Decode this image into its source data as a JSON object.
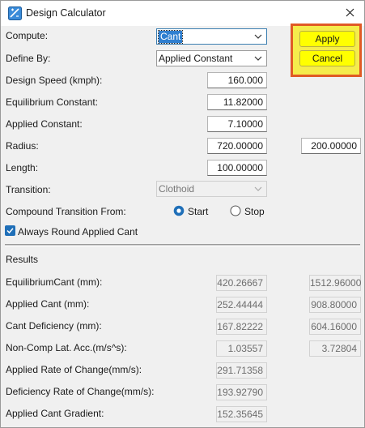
{
  "window": {
    "title": "Design Calculator"
  },
  "form": {
    "compute": {
      "label": "Compute:",
      "value": "Cant"
    },
    "define_by": {
      "label": "Define By:",
      "value": "Applied Constant"
    },
    "design_speed": {
      "label": "Design Speed (kmph):",
      "value": "160.000"
    },
    "equilibrium_constant": {
      "label": "Equilibrium Constant:",
      "value": "11.82000"
    },
    "applied_constant": {
      "label": "Applied Constant:",
      "value": "7.10000"
    },
    "radius": {
      "label": "Radius:",
      "value": "720.00000",
      "value2": "200.00000"
    },
    "length": {
      "label": "Length:",
      "value": "100.00000"
    },
    "transition": {
      "label": "Transition:",
      "value": "Clothoid"
    },
    "compound_transition": {
      "label": "Compound Transition From:",
      "options": [
        "Start",
        "Stop"
      ],
      "selected": "Start"
    },
    "always_round": {
      "label": "Always Round Applied Cant",
      "checked": true
    }
  },
  "buttons": {
    "apply": "Apply",
    "cancel": "Cancel"
  },
  "results": {
    "heading": "Results",
    "rows": [
      {
        "label": "EquilibriumCant (mm):",
        "value": "420.26667",
        "value2": "1512.96000"
      },
      {
        "label": "Applied Cant (mm):",
        "value": "252.44444",
        "value2": "908.80000"
      },
      {
        "label": "Cant Deficiency (mm):",
        "value": "167.82222",
        "value2": "604.16000"
      },
      {
        "label": "Non-Comp Lat. Acc.(m/s^s):",
        "value": "1.03557",
        "value2": "3.72804"
      },
      {
        "label": "Applied Rate of Change(mm/s):",
        "value": "291.71358"
      },
      {
        "label": "Deficiency Rate of Change(mm/s):",
        "value": "193.92790"
      },
      {
        "label": "Applied Cant Gradient:",
        "value": "152.35645"
      }
    ]
  },
  "colors": {
    "highlight_fill": "#f5ec4c",
    "highlight_border": "#e05a25",
    "button_fill": "#ffff00",
    "accent": "#1f6fb8"
  },
  "icons": {
    "app": "calculator-ruler-icon",
    "close": "close-icon",
    "dropdown": "chevron-down-icon"
  }
}
